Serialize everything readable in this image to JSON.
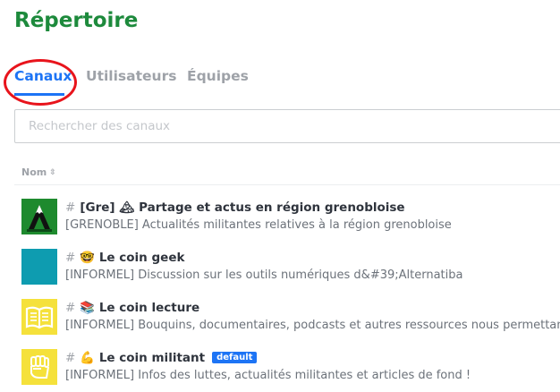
{
  "page": {
    "title": "Répertoire"
  },
  "tabs": [
    {
      "label": "Canaux",
      "active": true
    },
    {
      "label": "Utilisateurs",
      "active": false
    },
    {
      "label": "Équipes",
      "active": false
    }
  ],
  "search": {
    "placeholder": "Rechercher des canaux",
    "value": ""
  },
  "table": {
    "column_header": "Nom",
    "sort_icon": "⇳"
  },
  "channels": [
    {
      "hash": "#",
      "name": "[Gre] 🏔 Partage et actus en région grenobloise",
      "topic": "[GRENOBLE] Actualités militantes relatives à la région grenobloise",
      "avatar": "mountain-logo-icon",
      "badge": ""
    },
    {
      "hash": "#",
      "name": "🤓 Le coin geek",
      "topic": "[INFORMEL] Discussion sur les outils numériques d&#39;Alternatiba",
      "avatar": "teal-square-icon",
      "badge": ""
    },
    {
      "hash": "#",
      "name": "📚 Le coin lecture",
      "topic": "[INFORMEL] Bouquins, documentaires, podcasts et autres ressources nous permettant d",
      "avatar": "open-book-icon",
      "badge": ""
    },
    {
      "hash": "#",
      "name": "💪 Le coin militant",
      "topic": "[INFORMEL] Infos des luttes, actualités militantes et articles de fond !",
      "avatar": "raised-fist-icon",
      "badge": "default"
    }
  ],
  "colors": {
    "title": "#1d8a3c",
    "accent": "#1d74f5",
    "annotation": "#e8141c",
    "avatar_green": "#1e8a2e",
    "avatar_teal": "#0e9cb0",
    "avatar_yellow": "#f5e13b"
  }
}
